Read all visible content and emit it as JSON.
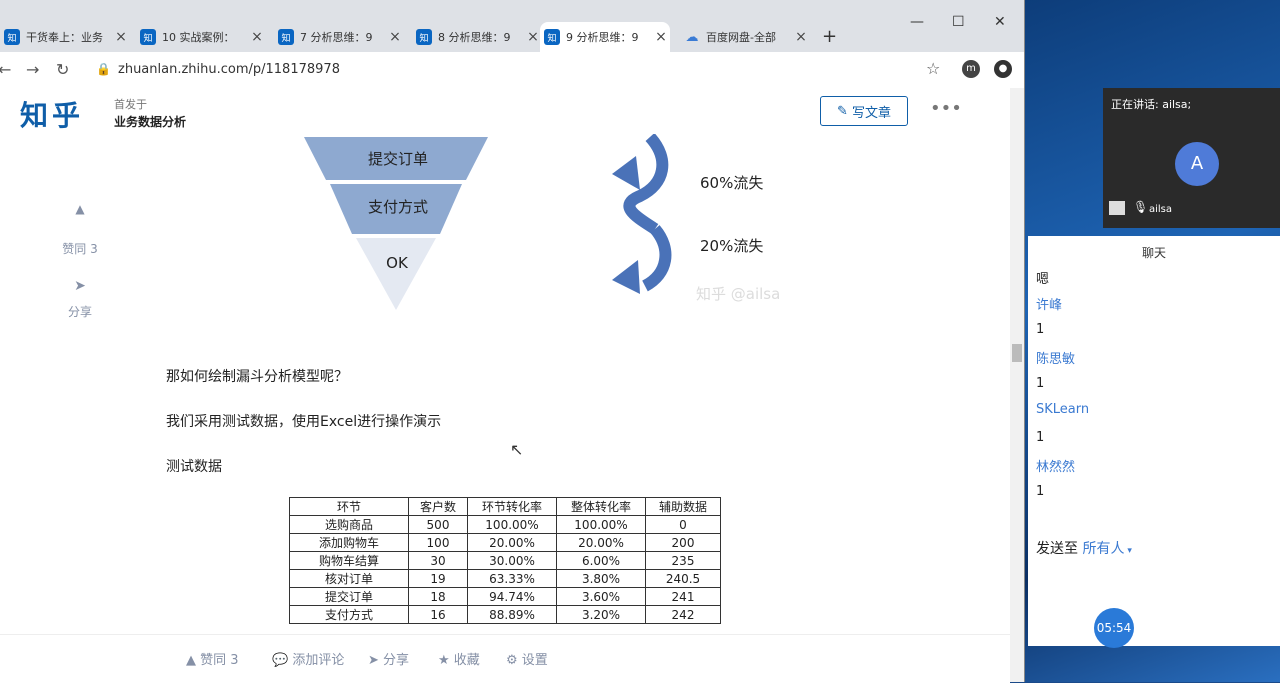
{
  "browser": {
    "tabs": [
      {
        "favicon": "知",
        "title": "干货奉上：业务",
        "active": false
      },
      {
        "favicon": "知",
        "title": "10 实战案例：",
        "active": false
      },
      {
        "favicon": "知",
        "title": "7 分析思维：9",
        "active": false
      },
      {
        "favicon": "知",
        "title": "8 分析思维：9",
        "active": false
      },
      {
        "favicon": "知",
        "title": "9 分析思维：9",
        "active": true
      },
      {
        "favicon": "cloud-icon",
        "title": "百度网盘-全部",
        "active": false
      }
    ],
    "url": "zhuanlan.zhihu.com/p/118178978",
    "ext_label": "m"
  },
  "header": {
    "logo": "知乎",
    "published_in": "首发于",
    "column_name": "业务数据分析",
    "write_button": "写文章"
  },
  "sidebar": {
    "upvote_label": "赞同 3",
    "share_label": "分享"
  },
  "figure": {
    "funnel_levels": [
      "提交订单",
      "支付方式",
      "OK"
    ],
    "loss_labels": [
      "60%流失",
      "20%流失"
    ],
    "watermark": "知乎 @ailsa"
  },
  "article": {
    "p1": "那如何绘制漏斗分析模型呢？",
    "p2": "我们采用测试数据，使用Excel进行操作演示",
    "p3": "测试数据"
  },
  "table": {
    "headers": [
      "环节",
      "客户数",
      "环节转化率",
      "整体转化率",
      "辅助数据"
    ],
    "rows": [
      [
        "选购商品",
        "500",
        "100.00%",
        "100.00%",
        "0"
      ],
      [
        "添加购物车",
        "100",
        "20.00%",
        "20.00%",
        "200"
      ],
      [
        "购物车结算",
        "30",
        "30.00%",
        "6.00%",
        "235"
      ],
      [
        "核对订单",
        "19",
        "63.33%",
        "3.80%",
        "240.5"
      ],
      [
        "提交订单",
        "18",
        "94.74%",
        "3.60%",
        "241"
      ],
      [
        "支付方式",
        "16",
        "88.89%",
        "3.20%",
        "242"
      ]
    ]
  },
  "bottombar": {
    "upvote": "赞同 3",
    "comment": "添加评论",
    "share": "分享",
    "favorite": "收藏",
    "settings": "设置"
  },
  "meeting": {
    "speaking": "正在讲话: ailsa;",
    "avatar_letter": "A",
    "participant": "ailsa",
    "timer": "05:54"
  },
  "chat": {
    "title": "聊天",
    "messages": [
      {
        "sender": "",
        "text": "嗯"
      },
      {
        "sender": "许峰",
        "text": "1"
      },
      {
        "sender": "陈思敏",
        "text": "1"
      },
      {
        "sender": "SKLearn",
        "text": "1"
      },
      {
        "sender": "林然然",
        "text": "1"
      }
    ],
    "send_to_label": "发送至",
    "send_to_target": "所有人"
  }
}
